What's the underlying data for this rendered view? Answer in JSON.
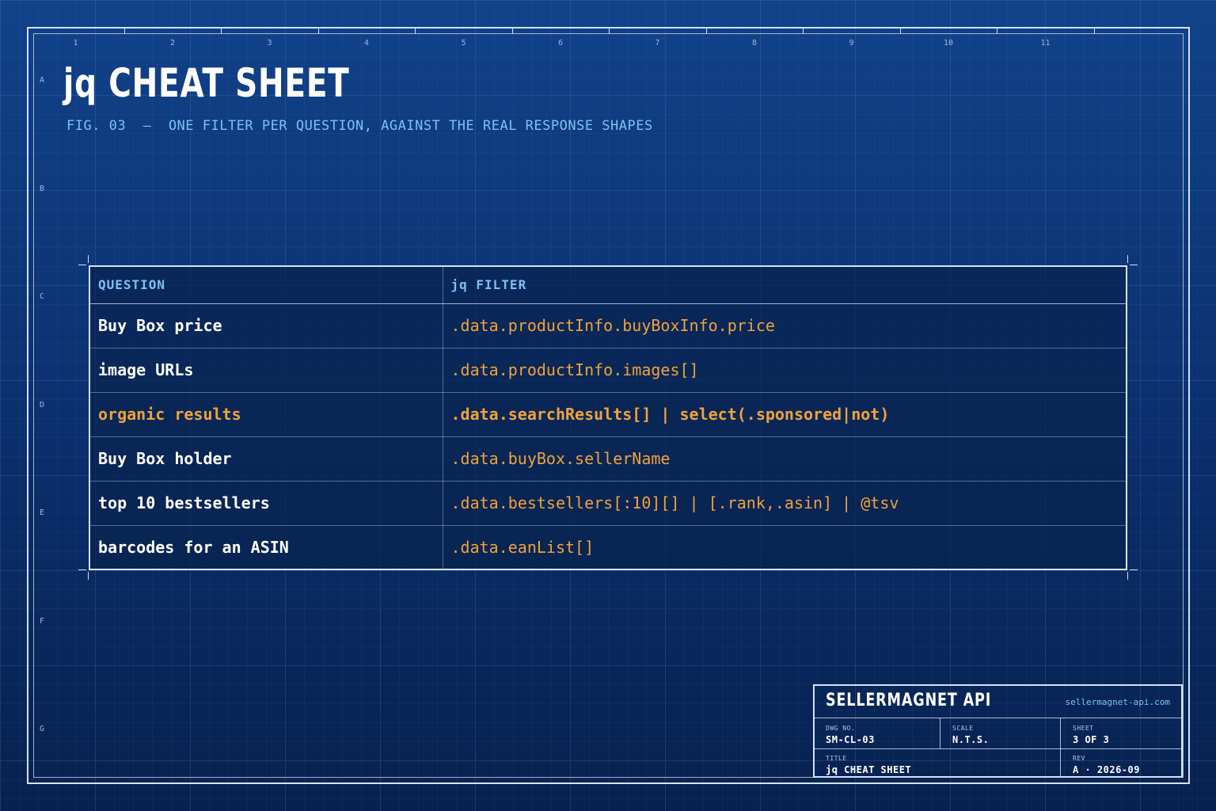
{
  "header": {
    "title": "jq CHEAT SHEET",
    "subtitle": "FIG. 03  —  ONE FILTER PER QUESTION, AGAINST THE REAL RESPONSE SHAPES"
  },
  "grid": {
    "columns": [
      "1",
      "2",
      "3",
      "4",
      "5",
      "6",
      "7",
      "8",
      "9",
      "10",
      "11"
    ],
    "rows": [
      "A",
      "B",
      "C",
      "D",
      "E",
      "F",
      "G"
    ]
  },
  "table": {
    "headers": {
      "question": "QUESTION",
      "filter": "jq FILTER"
    },
    "rows": [
      {
        "question": "Buy Box price",
        "filter": ".data.productInfo.buyBoxInfo.price",
        "highlighted": false
      },
      {
        "question": "image URLs",
        "filter": ".data.productInfo.images[]",
        "highlighted": false
      },
      {
        "question": "organic results",
        "filter": ".data.searchResults[] | select(.sponsored|not)",
        "highlighted": true
      },
      {
        "question": "Buy Box holder",
        "filter": ".data.buyBox.sellerName",
        "highlighted": false
      },
      {
        "question": "top 10 bestsellers",
        "filter": ".data.bestsellers[:10][] | [.rank,.asin] | @tsv",
        "highlighted": false
      },
      {
        "question": "barcodes for an ASIN",
        "filter": ".data.eanList[]",
        "highlighted": false
      }
    ]
  },
  "title_block": {
    "brand": "SELLERMAGNET API",
    "url": "sellermagnet-api.com",
    "dwg_no_label": "DWG NO.",
    "dwg_no": "SM-CL-03",
    "scale_label": "SCALE",
    "scale": "N.T.S.",
    "sheet_label": "SHEET",
    "sheet": "3 OF 3",
    "title_label": "TITLE",
    "title": "jq CHEAT SHEET",
    "rev_label": "REV",
    "rev": "A · 2026-09"
  },
  "colors": {
    "background": "#0c2d68",
    "accent_orange": "#f1a23a",
    "accent_blue": "#7cc2f2",
    "line": "#d4e2f6"
  }
}
